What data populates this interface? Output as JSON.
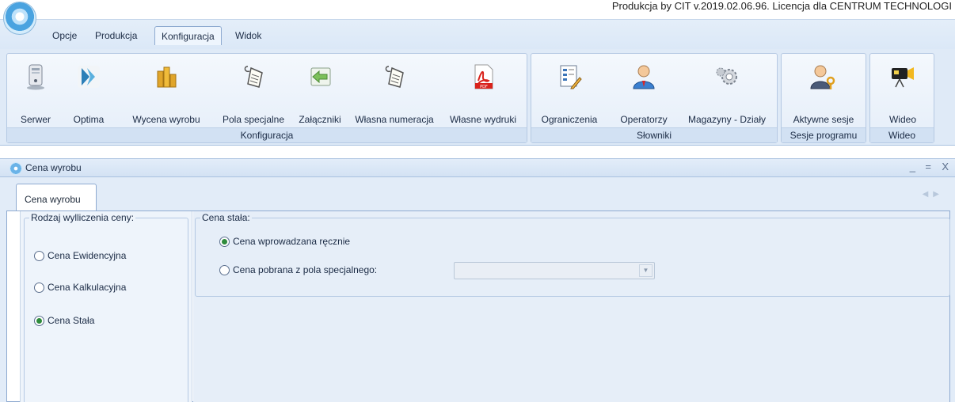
{
  "title": "Produkcja by CIT v.2019.02.06.96. Licencja dla CENTRUM TECHNOLOGI",
  "ribbon_tabs": [
    "Opcje",
    "Produkcja",
    "Konfiguracja",
    "Widok"
  ],
  "active_tab": "Konfiguracja",
  "groups": {
    "konfiguracja": {
      "label": "Konfiguracja",
      "buttons": [
        "Serwer",
        "Optima",
        "Wycena wyrobu",
        "Pola specjalne",
        "Załączniki",
        "Własna numeracja",
        "Własne wydruki"
      ]
    },
    "slowniki": {
      "label": "Słowniki",
      "buttons": [
        "Ograniczenia",
        "Operatorzy",
        "Magazyny - Działy"
      ]
    },
    "sesje": {
      "label": "Sesje programu",
      "buttons": [
        "Aktywne sesje"
      ]
    },
    "wideo": {
      "label": "Wideo",
      "buttons": [
        "Wideo"
      ]
    }
  },
  "window": {
    "title": "Cena wyrobu",
    "controls": [
      "_",
      "=",
      "X"
    ],
    "tab": "Cena wyrobu",
    "left": {
      "legend": "Rodzaj wylliczenia ceny:",
      "options": [
        "Cena Ewidencyjna",
        "Cena Kalkulacyjna",
        "Cena Stała"
      ],
      "selected": "Cena Stała"
    },
    "right": {
      "legend": "Cena stała:",
      "options": [
        "Cena wprowadzana ręcznie",
        "Cena pobrana z pola specjalnego:"
      ],
      "selected": "Cena wprowadzana ręcznie",
      "combo_value": ""
    }
  },
  "colors": {
    "ribbon_bg": "#dfeaf7",
    "accent_border": "#8eaad0",
    "radio_selected": "#2e8b3c"
  }
}
